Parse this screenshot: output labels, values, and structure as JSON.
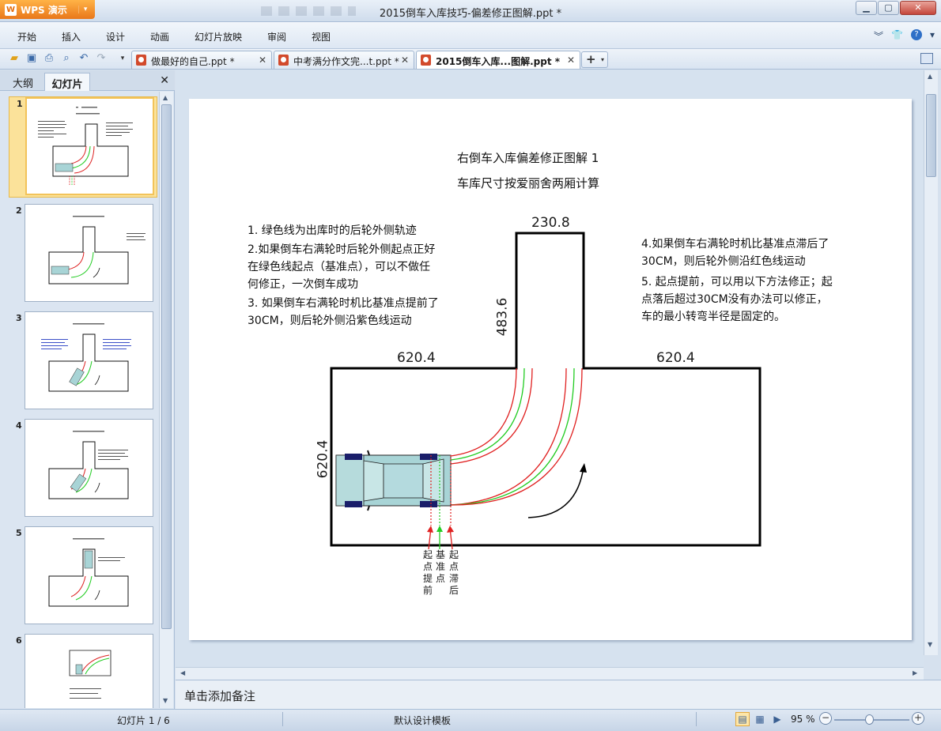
{
  "app": {
    "name": "WPS 演示",
    "logo_letter": "W"
  },
  "window": {
    "title": "2015倒车入库技巧-偏差修正图解.ppt *"
  },
  "menu": [
    "开始",
    "插入",
    "设计",
    "动画",
    "幻灯片放映",
    "审阅",
    "视图"
  ],
  "tabs": [
    {
      "label": "做最好的自己.ppt *"
    },
    {
      "label": "中考满分作文完...t.ppt *"
    },
    {
      "label": "2015倒车入库...图解.ppt *"
    }
  ],
  "pane": {
    "tab_outline": "大纲",
    "tab_slides": "幻灯片"
  },
  "slides": [
    {
      "num": "1"
    },
    {
      "num": "2"
    },
    {
      "num": "3"
    },
    {
      "num": "4"
    },
    {
      "num": "5"
    },
    {
      "num": "6"
    }
  ],
  "slide": {
    "title": "右倒车入库偏差修正图解 1",
    "subtitle": "车库尺寸按爱丽舍两厢计算",
    "left_notes": [
      "1. 绿色线为出库时的后轮外侧轨迹",
      "2.如果倒车右满轮时后轮外侧起点正好",
      "在绿色线起点（基准点），可以不做任",
      "何修正，一次倒车成功",
      "3. 如果倒车右满轮时机比基准点提前了",
      "30CM，则后轮外侧沿紫色线运动"
    ],
    "right_notes": [
      "4.如果倒车右满轮时机比基准点滞后了",
      "30CM，则后轮外侧沿红色线运动",
      "5. 起点提前，可以用以下方法修正；起",
      "点落后超过30CM没有办法可以修正，",
      "车的最小转弯半径是固定的。"
    ],
    "dims": {
      "garage_width": "230.8",
      "garage_depth": "483.6",
      "left_road": "620.4",
      "right_road": "620.4",
      "road_width": "620.4"
    },
    "markers": {
      "early": "起点提前",
      "base": "基准点",
      "late": "起点滞后"
    },
    "colors": {
      "green_track": "#22cc22",
      "red_track": "#e02020"
    }
  },
  "notes_placeholder": "单击添加备注",
  "status": {
    "slide": "幻灯片 1 / 6",
    "template": "默认设计模板",
    "zoom": "95 %"
  }
}
